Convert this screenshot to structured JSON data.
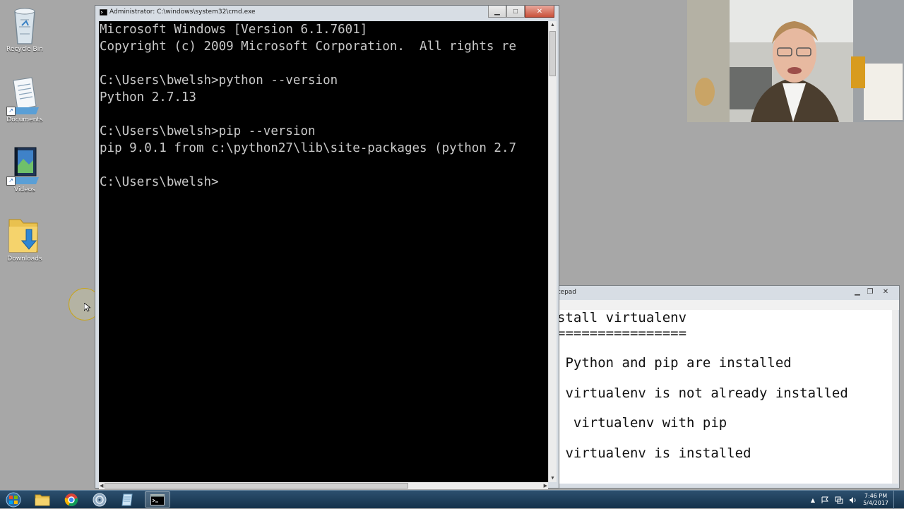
{
  "desktop": {
    "icons": [
      {
        "label": "Recycle Bin"
      },
      {
        "label": "Documents"
      },
      {
        "label": "Videos"
      },
      {
        "label": "Downloads"
      }
    ]
  },
  "cmd": {
    "title": "Administrator: C:\\windows\\system32\\cmd.exe",
    "lines": [
      "Microsoft Windows [Version 6.1.7601]",
      "Copyright (c) 2009 Microsoft Corporation.  All rights re",
      "",
      "C:\\Users\\bwelsh>python --version",
      "Python 2.7.13",
      "",
      "C:\\Users\\bwelsh>pip --version",
      "pip 9.0.1 from c:\\python27\\lib\\site-packages (python 2.7",
      "",
      "C:\\Users\\bwelsh>"
    ]
  },
  "notepad": {
    "title": "tepad",
    "lines": [
      "stall virtualenv",
      "================",
      " Python and pip are installed",
      " virtualenv is not already installed",
      "  virtualenv with pip",
      " virtualenv is installed"
    ]
  },
  "taskbar": {
    "clock_time": "7:46 PM",
    "clock_date": "5/4/2017"
  },
  "colors": {
    "console_bg": "#000000",
    "console_fg": "#c9c9c9",
    "taskbar": "#1f3d59",
    "desktop": "#a7a7a7"
  }
}
